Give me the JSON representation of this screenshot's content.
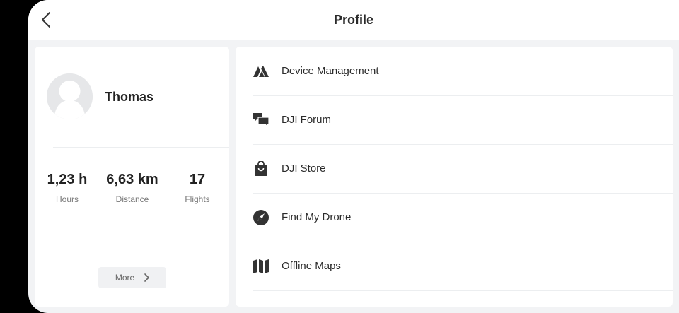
{
  "header": {
    "title": "Profile",
    "back_icon": "chevron-left-icon"
  },
  "profile": {
    "avatar_icon": "avatar-placeholder-icon",
    "name": "Thomas",
    "stats": [
      {
        "value": "1,23 h",
        "label": "Hours"
      },
      {
        "value": "6,63 km",
        "label": "Distance"
      },
      {
        "value": "17",
        "label": "Flights"
      }
    ],
    "more_label": "More",
    "more_icon": "chevron-right-icon"
  },
  "menu": {
    "items": [
      {
        "label": "Device Management",
        "icon": "device-management-icon"
      },
      {
        "label": "DJI Forum",
        "icon": "forum-chat-icon"
      },
      {
        "label": "DJI Store",
        "icon": "shopping-bag-icon"
      },
      {
        "label": "Find My Drone",
        "icon": "compass-icon"
      },
      {
        "label": "Offline Maps",
        "icon": "map-icon"
      }
    ]
  },
  "colors": {
    "background": "#f2f3f5",
    "card": "#ffffff",
    "text": "#2b2b2b",
    "muted": "#777777"
  }
}
